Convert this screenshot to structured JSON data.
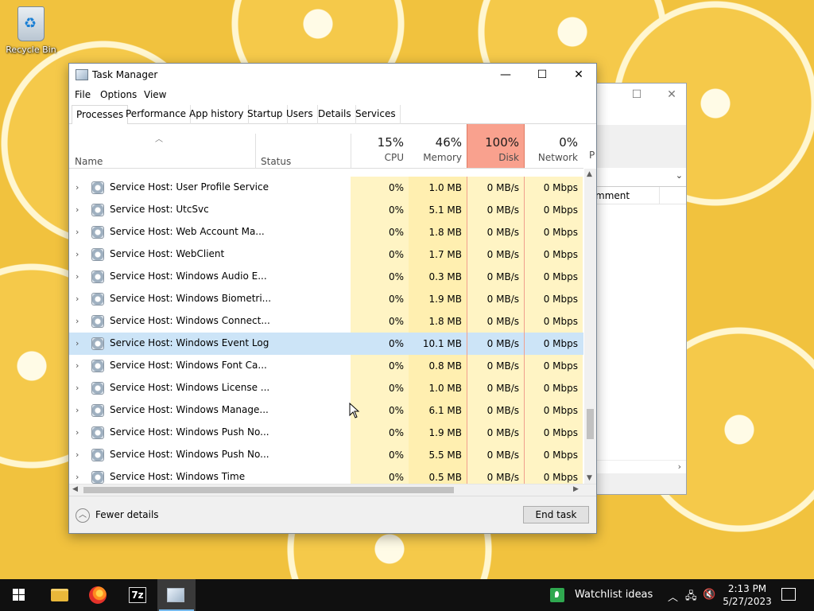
{
  "desktop": {
    "recycle_bin_label": "Recycle Bin"
  },
  "background_window": {
    "column_label": "mment"
  },
  "task_manager": {
    "title": "Task Manager",
    "menu": [
      "File",
      "Options",
      "View"
    ],
    "tabs": [
      "Processes",
      "Performance",
      "App history",
      "Startup",
      "Users",
      "Details",
      "Services"
    ],
    "active_tab": "Processes",
    "columns": {
      "name": "Name",
      "status": "Status",
      "cpu": {
        "pct": "15%",
        "label": "CPU"
      },
      "memory": {
        "pct": "46%",
        "label": "Memory"
      },
      "disk": {
        "pct": "100%",
        "label": "Disk"
      },
      "network": {
        "pct": "0%",
        "label": "Network"
      },
      "more": "P"
    },
    "rows": [
      {
        "name": "Service Host: User Profile Service",
        "cpu": "0%",
        "memory": "1.0 MB",
        "disk": "0 MB/s",
        "network": "0 Mbps"
      },
      {
        "name": "Service Host: UtcSvc",
        "cpu": "0%",
        "memory": "5.1 MB",
        "disk": "0 MB/s",
        "network": "0 Mbps"
      },
      {
        "name": "Service Host: Web Account Ma...",
        "cpu": "0%",
        "memory": "1.8 MB",
        "disk": "0 MB/s",
        "network": "0 Mbps"
      },
      {
        "name": "Service Host: WebClient",
        "cpu": "0%",
        "memory": "1.7 MB",
        "disk": "0 MB/s",
        "network": "0 Mbps"
      },
      {
        "name": "Service Host: Windows Audio E...",
        "cpu": "0%",
        "memory": "0.3 MB",
        "disk": "0 MB/s",
        "network": "0 Mbps"
      },
      {
        "name": "Service Host: Windows Biometri...",
        "cpu": "0%",
        "memory": "1.9 MB",
        "disk": "0 MB/s",
        "network": "0 Mbps"
      },
      {
        "name": "Service Host: Windows Connect...",
        "cpu": "0%",
        "memory": "1.8 MB",
        "disk": "0 MB/s",
        "network": "0 Mbps"
      },
      {
        "name": "Service Host: Windows Event Log",
        "cpu": "0%",
        "memory": "10.1 MB",
        "disk": "0 MB/s",
        "network": "0 Mbps",
        "selected": true
      },
      {
        "name": "Service Host: Windows Font Ca...",
        "cpu": "0%",
        "memory": "0.8 MB",
        "disk": "0 MB/s",
        "network": "0 Mbps"
      },
      {
        "name": "Service Host: Windows License ...",
        "cpu": "0%",
        "memory": "1.0 MB",
        "disk": "0 MB/s",
        "network": "0 Mbps"
      },
      {
        "name": "Service Host: Windows Manage...",
        "cpu": "0%",
        "memory": "6.1 MB",
        "disk": "0 MB/s",
        "network": "0 Mbps"
      },
      {
        "name": "Service Host: Windows Push No...",
        "cpu": "0%",
        "memory": "1.9 MB",
        "disk": "0 MB/s",
        "network": "0 Mbps"
      },
      {
        "name": "Service Host: Windows Push No...",
        "cpu": "0%",
        "memory": "5.5 MB",
        "disk": "0 MB/s",
        "network": "0 Mbps"
      },
      {
        "name": "Service Host: Windows Time",
        "cpu": "0%",
        "memory": "0.5 MB",
        "disk": "0 MB/s",
        "network": "0 Mbps"
      }
    ],
    "footer": {
      "fewer_details": "Fewer details",
      "end_task": "End task"
    }
  },
  "taskbar": {
    "pinned": [
      "start-icon",
      "file-explorer-icon",
      "firefox-icon",
      "7zip-icon",
      "task-manager-icon"
    ],
    "sevenzip_glyph": "7z",
    "notification_text": "Watchlist ideas",
    "time": "2:13 PM",
    "date": "5/27/2023"
  },
  "colors": {
    "disk_header": "#f9a18e",
    "heat_cell": "#fff4c4",
    "selected_row": "#cce4f7",
    "taskbar": "#101010"
  }
}
